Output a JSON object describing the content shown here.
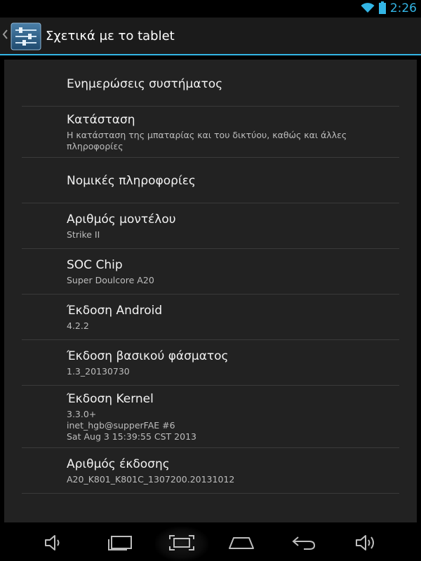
{
  "status_bar": {
    "time": "2:26",
    "icons": [
      "wifi-icon",
      "battery-icon"
    ]
  },
  "action_bar": {
    "title": "Σχετικά με το tablet",
    "icon": "settings-sliders-icon",
    "up_icon": "up-caret-icon"
  },
  "items": [
    {
      "title": "Ενημερώσεις συστήματος",
      "subtitle": ""
    },
    {
      "title": "Κατάσταση",
      "subtitle": "Η κατάσταση της μπαταρίας και του δικτύου, καθώς και άλλες\nπληροφορίες"
    },
    {
      "title": "Νομικές πληροφορίες",
      "subtitle": ""
    },
    {
      "title": "Αριθμός μοντέλου",
      "subtitle": "Strike II"
    },
    {
      "title": "SOC Chip",
      "subtitle": "Super Doulcore A20"
    },
    {
      "title": "Έκδοση Android",
      "subtitle": "4.2.2"
    },
    {
      "title": "Έκδοση βασικού φάσματος",
      "subtitle": "1.3_20130730"
    },
    {
      "title": "Έκδοση Kernel",
      "subtitle": "3.3.0+\ninet_hgb@supperFAE #6\nSat Aug 3 15:39:55 CST 2013"
    },
    {
      "title": "Αριθμός έκδοσης",
      "subtitle": "A20_K801_K801C_1307200.20131012"
    }
  ],
  "nav_bar": {
    "buttons": [
      "volume-down-icon",
      "back-icon",
      "recent-apps-icon",
      "screenshot-icon",
      "home-icon",
      "volume-up-icon"
    ]
  },
  "colors": {
    "accent": "#33b5e5",
    "background": "#000000",
    "card": "#222222",
    "divider": "#3a3a3a"
  }
}
